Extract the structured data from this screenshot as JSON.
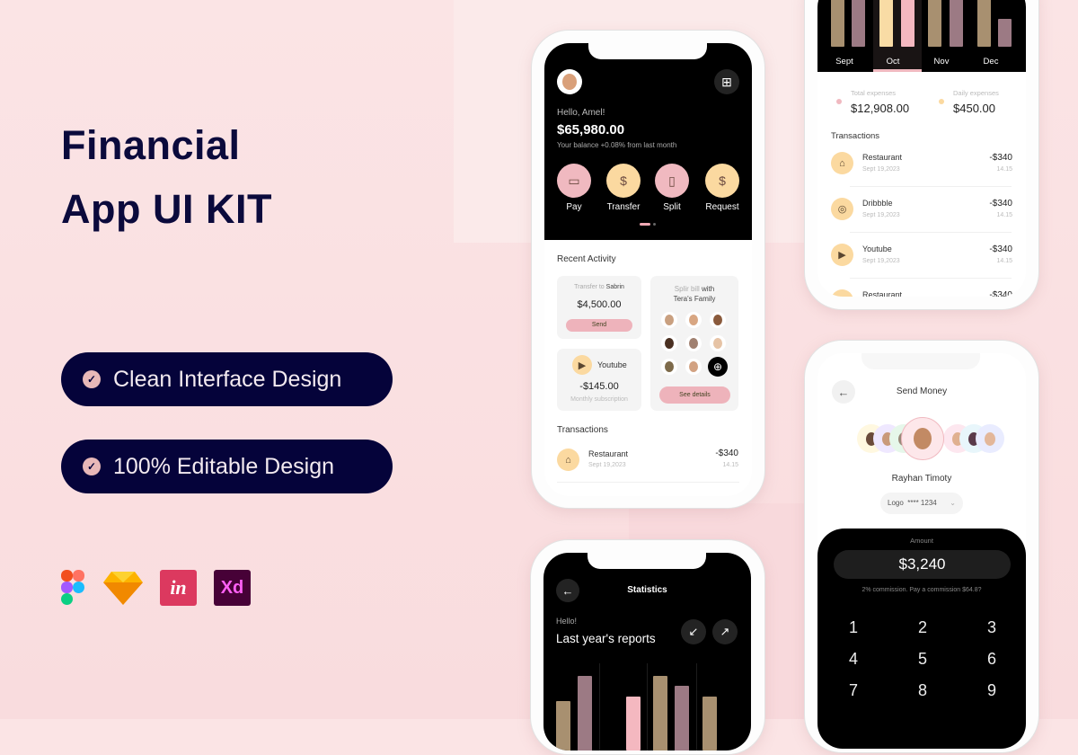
{
  "hero": {
    "title_line1": "Financial",
    "title_line2": "App UI KIT",
    "features": [
      "Clean Interface Design",
      "100% Editable Design"
    ],
    "tools": [
      {
        "name": "figma-logo"
      },
      {
        "name": "sketch-logo"
      },
      {
        "name": "invision-logo",
        "text": "in"
      },
      {
        "name": "xd-logo",
        "text": "Xd"
      }
    ]
  },
  "colors": {
    "navy": "#05033a",
    "pink": "#f0b9c0",
    "yellow": "#fbd9a0",
    "tan": "#a89070",
    "mauve": "#9c7a84"
  },
  "home": {
    "greeting": "Hello, Amel!",
    "balance": "$65,980.00",
    "balance_note": "Your balance +0.08% from last month",
    "actions": [
      {
        "label": "Pay",
        "icon": "wallet-icon",
        "glyph": "▭"
      },
      {
        "label": "Transfer",
        "icon": "transfer-icon",
        "glyph": "$"
      },
      {
        "label": "Split",
        "icon": "split-icon",
        "glyph": "▯"
      },
      {
        "label": "Request",
        "icon": "request-icon",
        "glyph": "$"
      }
    ],
    "recent_title": "Recent Activity",
    "transfer": {
      "prefix": "Transfer to",
      "name": "Sabrin",
      "amount": "$4,500.00",
      "button": "Send"
    },
    "subscription": {
      "name": "Youtube",
      "amount": "-$145.00",
      "note": "Monthly subscription"
    },
    "split": {
      "prefix": "Splir bill",
      "suffix": "with",
      "group": "Tera's Family",
      "button": "See details"
    },
    "transactions_title": "Transactions",
    "transactions": [
      {
        "name": "Restaurant",
        "date": "Sept 19,2023",
        "amount": "-$340",
        "time": "14.15"
      }
    ]
  },
  "expenses": {
    "months": [
      "Sept",
      "Oct",
      "Nov",
      "Dec"
    ],
    "selected_month": "Oct",
    "bars": [
      [
        100,
        100
      ],
      [
        70,
        100
      ],
      [
        100,
        100
      ],
      [
        100,
        35
      ]
    ],
    "total_label": "Total expenses",
    "total": "$12,908.00",
    "daily_label": "Daily expenses",
    "daily": "$450.00",
    "transactions_title": "Transactions",
    "transactions": [
      {
        "name": "Restaurant",
        "date": "Sept 19,2023",
        "amount": "-$340",
        "time": "14.15",
        "icon": "restaurant-icon",
        "glyph": "⌂"
      },
      {
        "name": "Dribbble",
        "date": "Sept 19,2023",
        "amount": "-$340",
        "time": "14.15",
        "icon": "dribbble-icon",
        "glyph": "◎"
      },
      {
        "name": "Youtube",
        "date": "Sept 19,2023",
        "amount": "-$340",
        "time": "14.15",
        "icon": "youtube-icon",
        "glyph": "▶"
      },
      {
        "name": "Restaurant",
        "date": "",
        "amount": "-$340",
        "time": "",
        "icon": "restaurant-icon",
        "glyph": "⌂"
      }
    ]
  },
  "send": {
    "title": "Send Money",
    "recipient": "Rayhan Timoty",
    "account": "Logo  **** 1234",
    "amount_label": "Amount",
    "amount": "$3,240",
    "commission": "2% commission. Pay a commission $64.8?",
    "keys": [
      "1",
      "2",
      "3",
      "4",
      "5",
      "6",
      "7",
      "8",
      "9"
    ]
  },
  "stats": {
    "title": "Statistics",
    "hello": "Hello!",
    "heading": "Last year's reports"
  }
}
